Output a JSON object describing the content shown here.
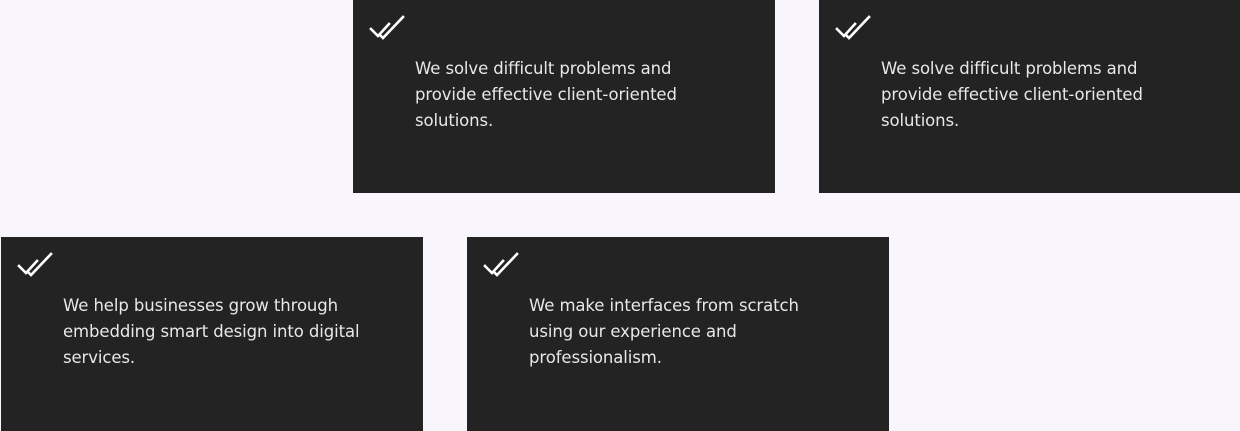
{
  "cards": [
    {
      "icon": "double-check-icon",
      "text": "We solve difficult problems and provide effective client-oriented solutions."
    },
    {
      "icon": "double-check-icon",
      "text": "We solve difficult problems and provide effective client-oriented solutions."
    },
    {
      "icon": "double-check-icon",
      "text": "We help businesses grow through embedding smart design into digital services."
    },
    {
      "icon": "double-check-icon",
      "text": "We make interfaces from scratch using our experience and professionalism."
    }
  ],
  "colors": {
    "background": "#f8f5fd",
    "card": "#232323",
    "text": "#e8e8e8",
    "icon": "#ffffff"
  }
}
